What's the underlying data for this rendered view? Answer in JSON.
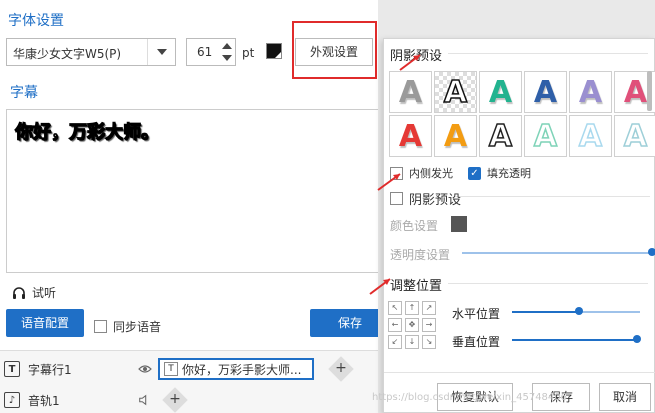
{
  "font_settings": {
    "title": "字体设置",
    "font_name": "华康少女文字W5(P)",
    "font_size": "61",
    "unit": "pt",
    "appearance_button": "外观设置"
  },
  "subtitle": {
    "title": "字幕",
    "text": "你好，万彩大师。"
  },
  "controls": {
    "listen": "试听",
    "voice_config": "语音配置",
    "sync_voice": "同步语音",
    "save": "保存"
  },
  "timeline": {
    "subtitle_track": "字幕行1",
    "clip_text": "你好，万彩手影大师...",
    "audio_track": "音轨1"
  },
  "appearance_panel": {
    "shadow_preset_title": "阴影预设",
    "inner_glow": "内侧发光",
    "fill_transparent": "填充透明",
    "shadow_preset_check": "阴影预设",
    "color_setting": "颜色设置",
    "opacity_setting": "透明度设置",
    "adjust_position": "调整位置",
    "horizontal": "水平位置",
    "vertical": "垂直位置",
    "restore_default": "恢复默认",
    "save": "保存",
    "cancel": "取消",
    "horizontal_value": 0.52,
    "vertical_value": 0.98,
    "opacity_value": 1.0
  },
  "style_presets": [
    {
      "glyph": "A",
      "color": "#9a9a9a",
      "variant": "pencil-gray"
    },
    {
      "glyph": "A",
      "color": "#ffffff",
      "variant": "outline-checker"
    },
    {
      "glyph": "A",
      "color": "#22b38f",
      "variant": "teal"
    },
    {
      "glyph": "A",
      "color": "#2f5fa8",
      "variant": "blue"
    },
    {
      "glyph": "A",
      "color": "#9a8fd0",
      "variant": "lavender"
    },
    {
      "glyph": "A",
      "color": "#e0507a",
      "variant": "pink"
    },
    {
      "glyph": "A",
      "color": "#e53935",
      "variant": "red"
    },
    {
      "glyph": "A",
      "color": "#f39c12",
      "variant": "orange"
    },
    {
      "glyph": "A",
      "color": "#222222",
      "variant": "black-outline"
    },
    {
      "glyph": "A",
      "color": "#7fd3b8",
      "variant": "mint-outline"
    },
    {
      "glyph": "A",
      "color": "#a9d9ee",
      "variant": "sky-outline"
    },
    {
      "glyph": "A",
      "color": "#9ecfd8",
      "variant": "aqua-outline"
    }
  ],
  "colors": {
    "accent": "#1f6fc6",
    "highlight_box": "#e02b2b"
  },
  "watermark": "https://blog.csdn.net/weixin_45748406"
}
